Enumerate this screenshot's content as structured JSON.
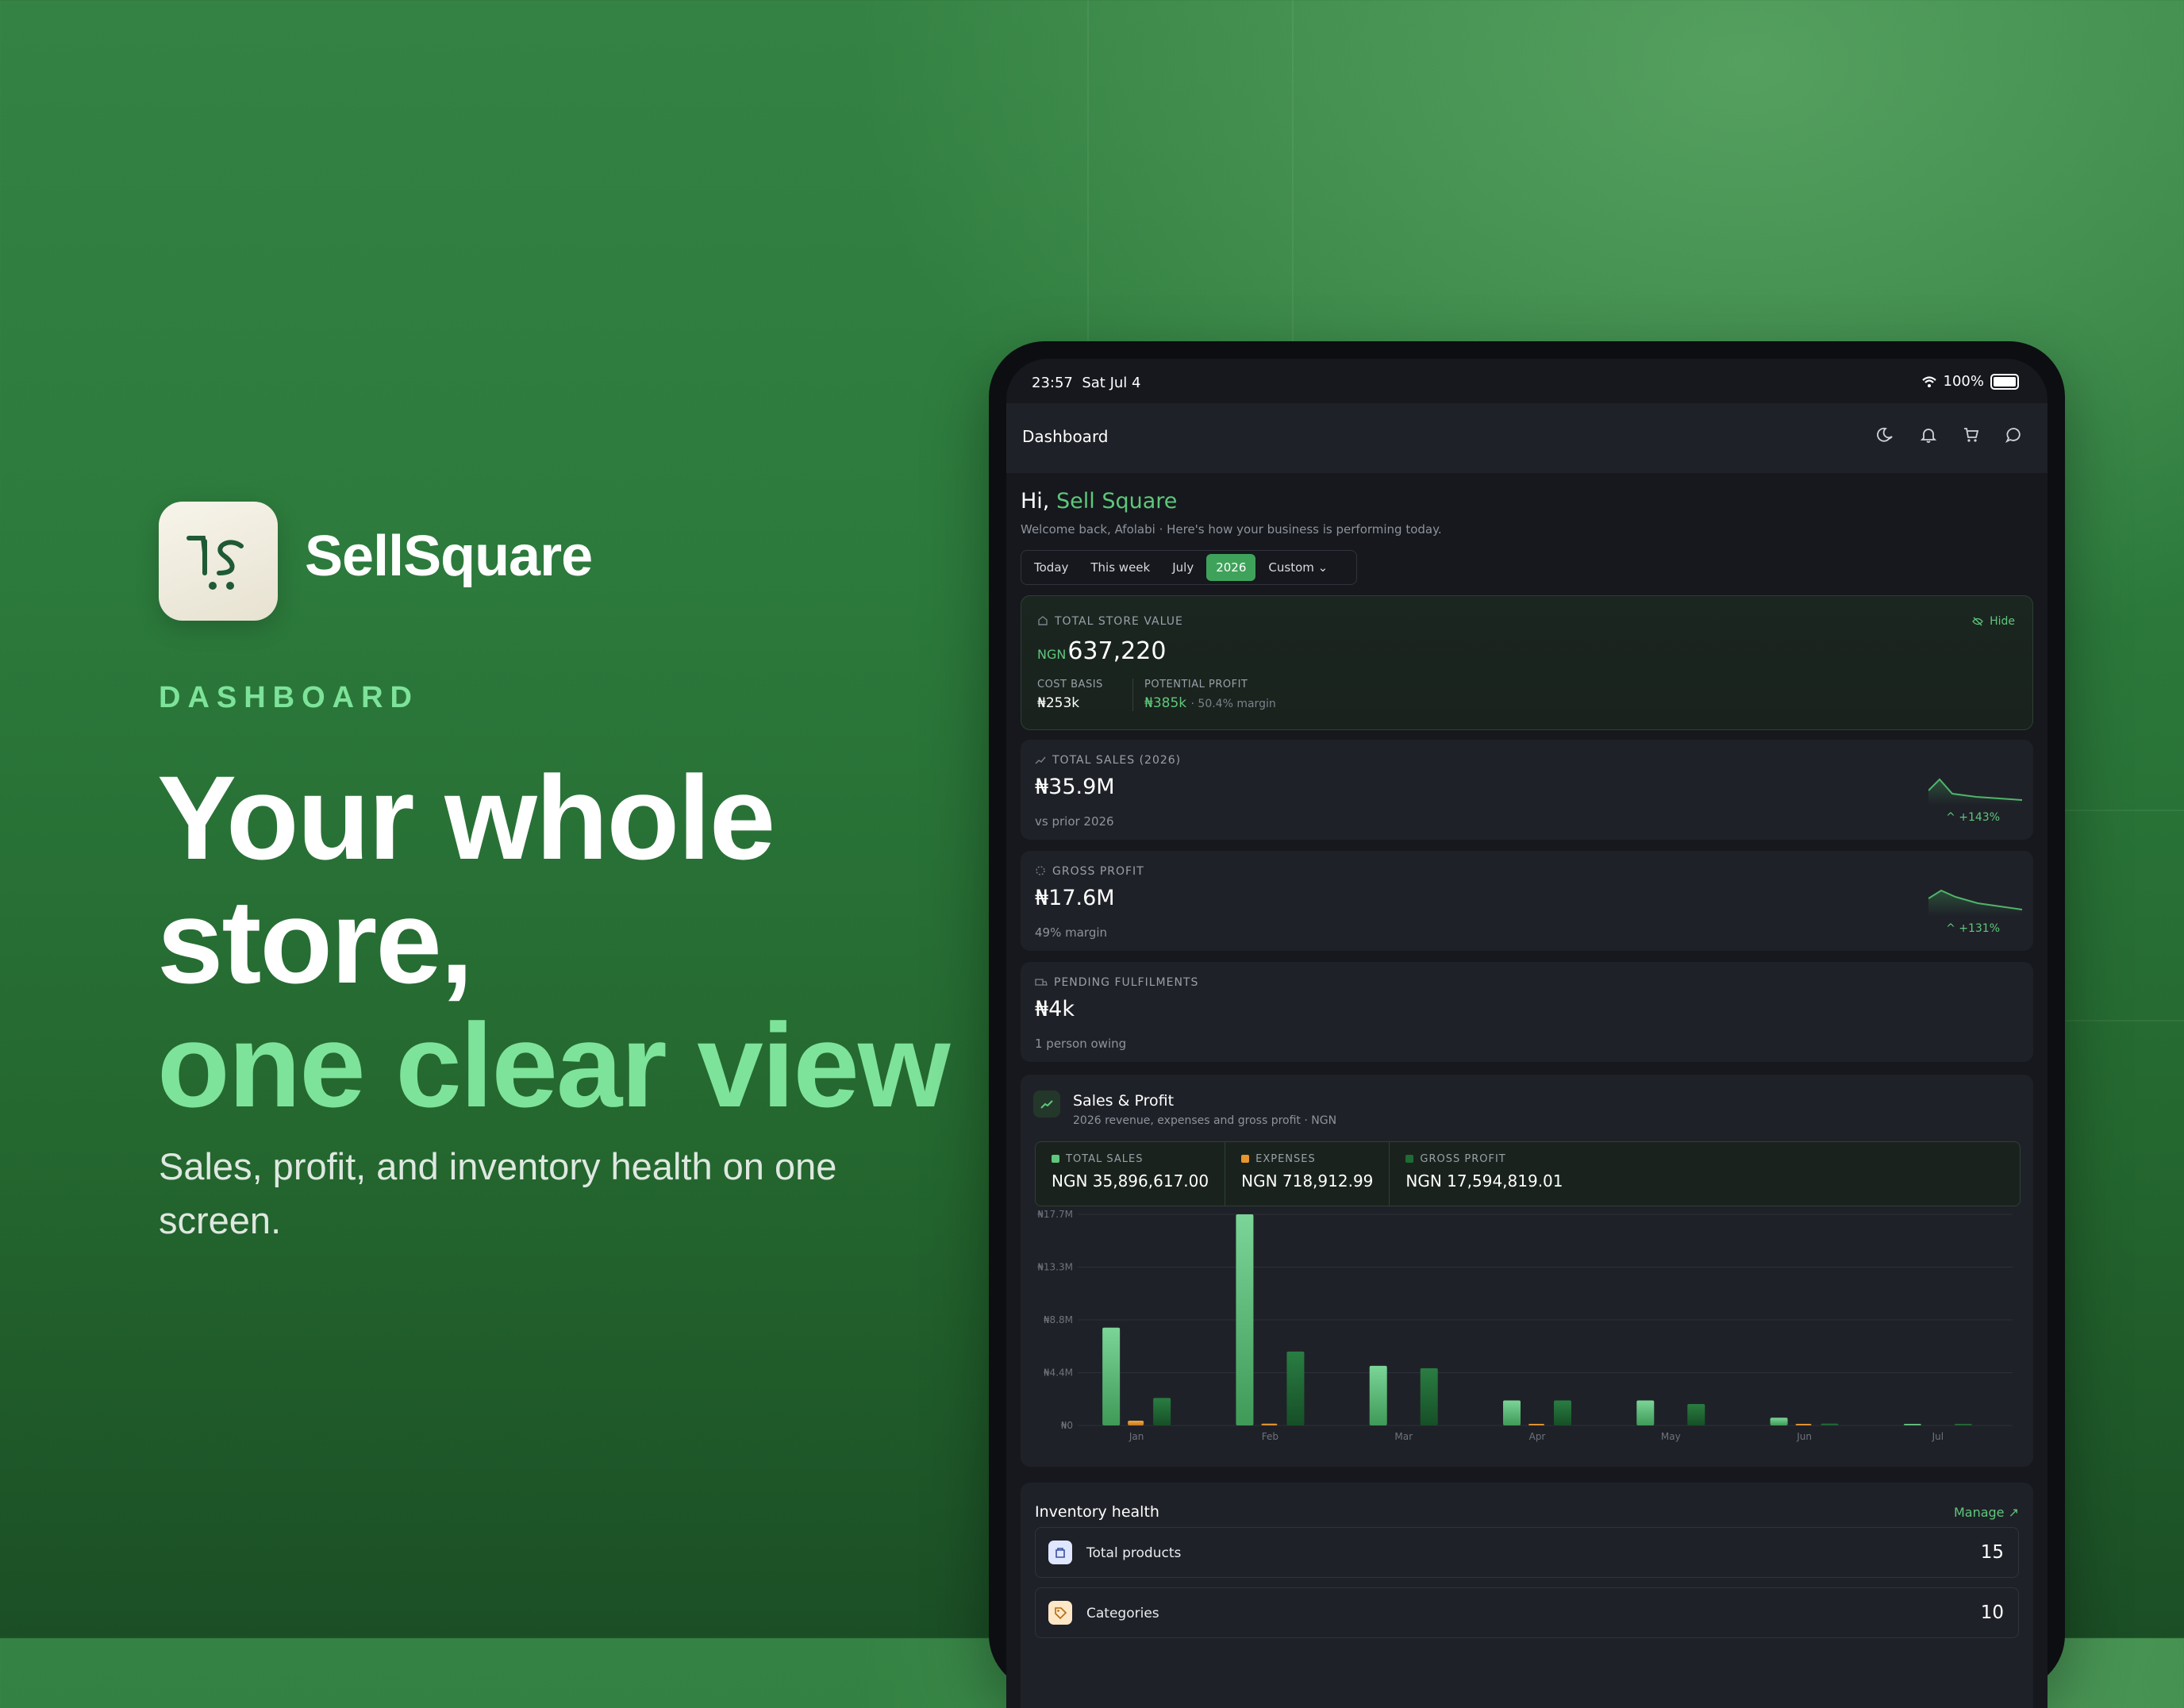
{
  "brand": {
    "name": "SellSquare",
    "eyebrow": "DASHBOARD"
  },
  "hero": {
    "line1": "Your whole",
    "line2": "store,",
    "line3": "one clear view",
    "subcopy": "Sales, profit, and inventory health on one screen."
  },
  "status": {
    "time": "23:57",
    "date": "Sat Jul 4",
    "battery": "100%"
  },
  "appbar": {
    "title": "Dashboard"
  },
  "greeting": {
    "hi": "Hi,",
    "name": "Sell Square",
    "welcome": "Welcome back, Afolabi · Here's how your business is performing today."
  },
  "periods": [
    {
      "label": "Today"
    },
    {
      "label": "This week"
    },
    {
      "label": "July"
    },
    {
      "label": "2026"
    },
    {
      "label": "Custom ⌄"
    }
  ],
  "store_value": {
    "label": "TOTAL STORE VALUE",
    "hide": "Hide",
    "currency": "NGN",
    "amount": "637,220",
    "cost_label": "COST BASIS",
    "cost_value": "₦253k",
    "profit_label": "POTENTIAL PROFIT",
    "profit_value": "₦385k",
    "profit_note": "· 50.4% margin"
  },
  "metrics": [
    {
      "label": "TOTAL SALES (2026)",
      "value": "₦35.9M",
      "note": "vs prior 2026",
      "delta": "^ +143%"
    },
    {
      "label": "GROSS PROFIT",
      "value": "₦17.6M",
      "note": "49% margin",
      "delta": "^ +131%"
    },
    {
      "label": "PENDING FULFILMENTS",
      "value": "₦4k",
      "note": "1 person owing",
      "delta": ""
    }
  ],
  "sales_profit": {
    "title": "Sales & Profit",
    "subtitle": "2026 revenue, expenses and gross profit · NGN",
    "legend": [
      {
        "name": "TOTAL SALES",
        "value": "NGN 35,896,617.00",
        "color": "#5fc77b"
      },
      {
        "name": "EXPENSES",
        "value": "NGN 718,912.99",
        "color": "#e8952e"
      },
      {
        "name": "GROSS PROFIT",
        "value": "NGN 17,594,819.01",
        "color": "#1f6b35"
      }
    ]
  },
  "chart_data": {
    "type": "bar",
    "categories": [
      "Jan",
      "Feb",
      "Mar",
      "Apr",
      "May",
      "Jun",
      "Jul"
    ],
    "series": [
      {
        "name": "TOTAL SALES",
        "values": [
          8.2,
          17.7,
          5.0,
          2.1,
          2.1,
          0.65,
          0.1
        ]
      },
      {
        "name": "EXPENSES",
        "values": [
          0.4,
          0.15,
          0.0,
          0.05,
          0.0,
          0.1,
          0.0
        ]
      },
      {
        "name": "GROSS PROFIT",
        "values": [
          2.3,
          6.2,
          4.8,
          2.1,
          1.8,
          0.15,
          0.05
        ]
      }
    ],
    "yticks": [
      "₦0",
      "₦4.4M",
      "₦8.8M",
      "₦13.3M",
      "₦17.7M"
    ],
    "ylim": [
      0,
      17.7
    ],
    "grid": true
  },
  "inventory": {
    "title": "Inventory health",
    "manage": "Manage ↗",
    "rows": [
      {
        "label": "Total products",
        "value": "15",
        "color": "#dfe6ff"
      },
      {
        "label": "Categories",
        "value": "10",
        "color": "#fde7c6"
      }
    ]
  }
}
